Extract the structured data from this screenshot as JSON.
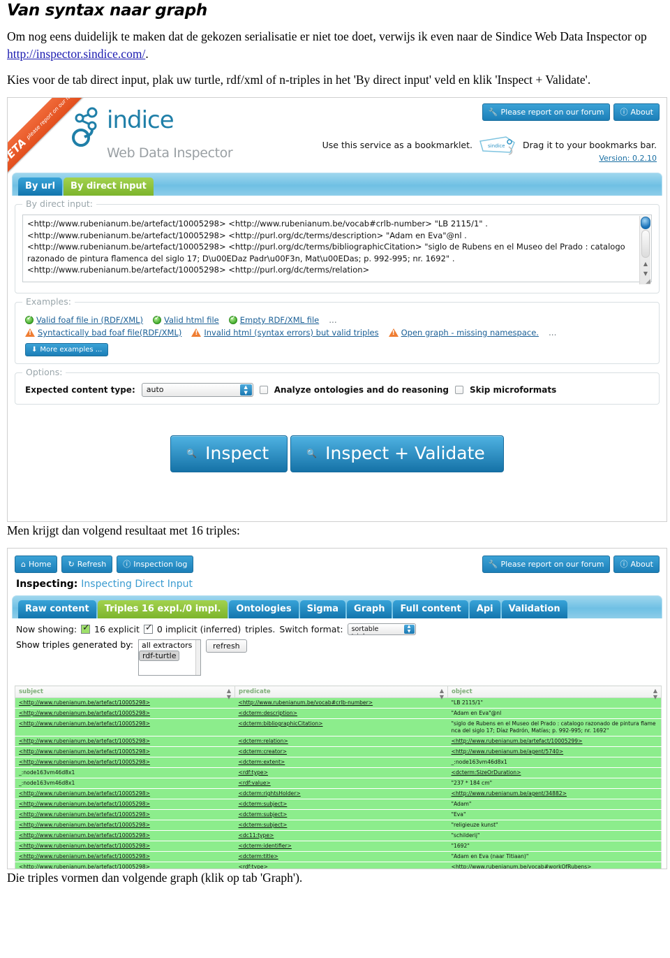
{
  "doc": {
    "title": "Van syntax naar graph",
    "para1_a": "Om nog eens duidelijk te maken dat de gekozen serialisatie er niet toe doet, verwijs ik even naar de Sindice Web Data Inspector op ",
    "para1_link": "http://inspector.sindice.com/",
    "para1_b": ".",
    "para2": "Kies voor de tab direct input, plak uw turtle, rdf/xml of n-triples in het 'By direct input' veld en klik 'Inspect + Validate'.",
    "para3": "Men krijgt dan volgend resultaat met 16 triples:",
    "para4": "Die triples vormen dan volgende graph (klik op tab 'Graph')."
  },
  "inspector": {
    "ribbon": {
      "beta": "BETA",
      "sub": "please report on our forum"
    },
    "logo": {
      "word": "indice",
      "sub": "Web Data Inspector"
    },
    "topbuttons": [
      {
        "icon": "wrench-icon",
        "label": "Please report on our forum"
      },
      {
        "icon": "info-icon",
        "label": "About"
      }
    ],
    "bookmarklet": {
      "before": "Use this service as a bookmarklet.",
      "tag_label": "sindice",
      "after": "Drag it to your bookmarks bar."
    },
    "version": "Version: 0.2.10",
    "tabs": [
      {
        "label": "By url",
        "active": false
      },
      {
        "label": "By direct input",
        "active": true
      }
    ],
    "direct_input": {
      "legend": "By direct input:",
      "value": "<http://www.rubenianum.be/artefact/10005298> <http://www.rubenianum.be/vocab#crlb-number> \"LB 2115/1\" .\n<http://www.rubenianum.be/artefact/10005298> <http://purl.org/dc/terms/description> \"Adam en Eva\"@nl .\n<http://www.rubenianum.be/artefact/10005298> <http://purl.org/dc/terms/bibliographicCitation> \"siglo de Rubens en el Museo del Prado : catalogo razonado de pintura flamenca del siglo 17; D\\u00EDaz Padr\\u00F3n, Mat\\u00EDas; p. 992-995; nr. 1692\" .\n<http://www.rubenianum.be/artefact/10005298> <http://purl.org/dc/terms/relation>"
    },
    "examples": {
      "legend": "Examples:",
      "row1": [
        {
          "icon": "ok-icon",
          "label": "Valid foaf file in (RDF/XML)"
        },
        {
          "icon": "ok-icon",
          "label": "Valid html file"
        },
        {
          "icon": "ok-icon",
          "label": "Empty RDF/XML file"
        }
      ],
      "row1_more": "...",
      "row2": [
        {
          "icon": "warning-icon",
          "label": "Syntactically bad foaf file(RDF/XML)"
        },
        {
          "icon": "warning-icon",
          "label": "Invalid html (syntax errors) but valid triples"
        },
        {
          "icon": "warning-icon",
          "label": "Open graph - missing namespace."
        }
      ],
      "row2_more": "...",
      "more_button": "More examples ..."
    },
    "options": {
      "legend": "Options:",
      "content_type_label": "Expected content type:",
      "content_type_value": "auto",
      "checkbox1": "Analyze ontologies and do reasoning",
      "checkbox2": "Skip microformats"
    },
    "actions": {
      "inspect": "Inspect",
      "inspect_validate": "Inspect + Validate"
    }
  },
  "result": {
    "navbuttons": [
      {
        "icon": "home-icon",
        "label": "Home"
      },
      {
        "icon": "refresh-icon",
        "label": "Refresh"
      },
      {
        "icon": "log-icon",
        "label": "Inspection log"
      }
    ],
    "topbuttons": [
      {
        "icon": "wrench-icon",
        "label": "Please report on our forum"
      },
      {
        "icon": "info-icon",
        "label": "About"
      }
    ],
    "inspecting_label": "Inspecting:",
    "inspecting_value": "Inspecting Direct Input",
    "tabs": [
      {
        "label": "Raw content",
        "active": false
      },
      {
        "label": "Triples 16 expl./0 impl.",
        "active": true
      },
      {
        "label": "Ontologies",
        "active": false
      },
      {
        "label": "Sigma",
        "active": false
      },
      {
        "label": "Graph",
        "active": false
      },
      {
        "label": "Full content",
        "active": false
      },
      {
        "label": "Api",
        "active": false
      },
      {
        "label": "Validation",
        "active": false
      }
    ],
    "now_showing": {
      "prefix": "Now showing:",
      "explicit": "16 explicit",
      "implicit": "0 implicit (inferred)",
      "suffix": "triples.",
      "switch_label": "Switch format:",
      "format_value": "sortable triples"
    },
    "generated_by": {
      "label": "Show triples generated by:",
      "options": [
        "all extractors",
        "rdf-turtle"
      ],
      "selected": "rdf-turtle",
      "refresh": "refresh"
    },
    "table": {
      "headers": [
        "subject",
        "predicate",
        "object"
      ],
      "rows": [
        [
          "<http://www.rubenianum.be/artefact/10005298>",
          "<http://www.rubenianum.be/vocab#crlb-number>",
          "\"LB 2115/1\""
        ],
        [
          "<http://www.rubenianum.be/artefact/10005298>",
          "<dcterm:description>",
          "\"Adam en Eva\"@nl"
        ],
        [
          "<http://www.rubenianum.be/artefact/10005298>",
          "<dcterm:bibliographicCitation>",
          "\"siglo de Rubens en el Museo del Prado : catalogo razonado de pintura flamenca del siglo 17; Díaz Padrón, Matías; p. 992-995; nr. 1692\""
        ],
        [
          "<http://www.rubenianum.be/artefact/10005298>",
          "<dcterm:relation>",
          "<http://www.rubenianum.be/artefact/10005299>"
        ],
        [
          "<http://www.rubenianum.be/artefact/10005298>",
          "<dcterm:creator>",
          "<http://www.rubenianum.be/agent/5740>"
        ],
        [
          "<http://www.rubenianum.be/artefact/10005298>",
          "<dcterm:extent>",
          "_:node163vm46d8x1"
        ],
        [
          "_:node163vm46d8x1",
          "<rdf:type>",
          "<dcterm:SizeOrDuration>"
        ],
        [
          "_:node163vm46d8x1",
          "<rdf:value>",
          "\"237 * 184 cm\""
        ],
        [
          "<http://www.rubenianum.be/artefact/10005298>",
          "<dcterm:rightsHolder>",
          "<http://www.rubenianum.be/agent/34882>"
        ],
        [
          "<http://www.rubenianum.be/artefact/10005298>",
          "<dcterm:subject>",
          "\"Adam\""
        ],
        [
          "<http://www.rubenianum.be/artefact/10005298>",
          "<dcterm:subject>",
          "\"Eva\""
        ],
        [
          "<http://www.rubenianum.be/artefact/10005298>",
          "<dcterm:subject>",
          "\"religieuze kunst\""
        ],
        [
          "<http://www.rubenianum.be/artefact/10005298>",
          "<dc11:type>",
          "\"schilderij\""
        ],
        [
          "<http://www.rubenianum.be/artefact/10005298>",
          "<dcterm:identifier>",
          "\"1692\""
        ],
        [
          "<http://www.rubenianum.be/artefact/10005298>",
          "<dcterm:title>",
          "\"Adam en Eva (naar Titiaan)\""
        ],
        [
          "<http://www.rubenianum.be/artefact/10005298>",
          "<rdf:type>",
          "<http://www.rubenianum.be/vocab#workOfRubens>"
        ]
      ],
      "link_cells": {
        "subject_link_rows": [
          0,
          1,
          2,
          3,
          4,
          5,
          8,
          9,
          10,
          11,
          12,
          13,
          14,
          15
        ],
        "predicate_link_all": true,
        "object_link_rows": [
          3,
          4,
          6,
          8,
          15
        ]
      }
    }
  },
  "colors": {
    "brand_blue": "#1f7fa8",
    "tab_green": "#8cc63f",
    "row_green": "#8ced8c",
    "ribbon_orange": "#e24f1d",
    "link_blue": "#1a1ab0"
  }
}
